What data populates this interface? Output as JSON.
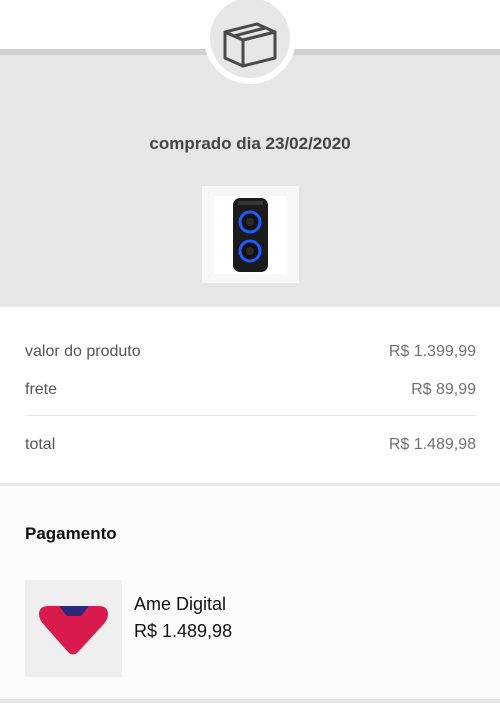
{
  "header": {
    "icon": "package-box-icon",
    "purchase_date": "comprado dia 23/02/2020",
    "product_image": "speaker-product-image"
  },
  "summary": {
    "product_label": "valor do produto",
    "product_value": "R$ 1.399,99",
    "shipping_label": "frete",
    "shipping_value": "R$ 89,99",
    "total_label": "total",
    "total_value": "R$ 1.489,98"
  },
  "payment": {
    "title": "Pagamento",
    "method_icon": "ame-digital-logo",
    "method_name": "Ame Digital",
    "method_amount": "R$ 1.489,98"
  },
  "colors": {
    "header_background": "#e6e6e6",
    "ame_magenta": "#d81b4c",
    "ame_navy": "#2b2a7a",
    "speaker_blue": "#1e5cff"
  }
}
